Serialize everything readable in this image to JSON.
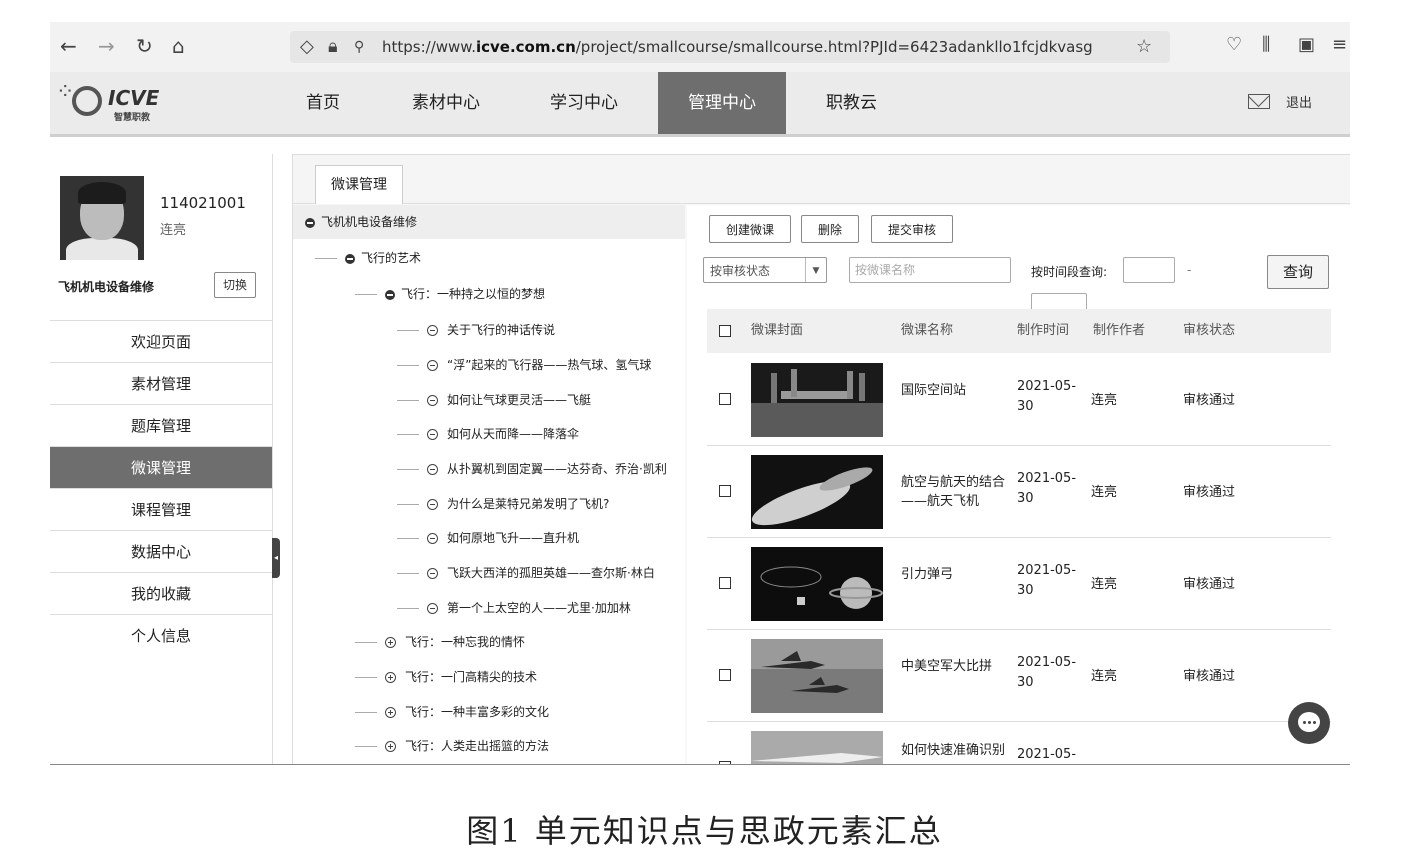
{
  "browser": {
    "url_prefix": "https://www.",
    "url_domain": "icve.com.cn",
    "url_path": "/project/smallcourse/smallcourse.html?PJId=6423adankllo1fcjdkvasg"
  },
  "site": {
    "brand": "icve",
    "brand_sub": "智慧职教",
    "menu": [
      "首页",
      "素材中心",
      "学习中心",
      "管理中心",
      "职教云"
    ],
    "logout": "退出"
  },
  "user": {
    "id": "114021001",
    "name": "连亮",
    "course": "飞机机电设备维修",
    "switch_label": "切换"
  },
  "sidebar": {
    "items": [
      "欢迎页面",
      "素材管理",
      "题库管理",
      "微课管理",
      "课程管理",
      "数据中心",
      "我的收藏",
      "个人信息"
    ]
  },
  "tab": "微课管理",
  "tree": {
    "root": "飞机机电设备维修",
    "level1": "飞行的艺术",
    "level2_open": "飞行：一种持之以恒的梦想",
    "leaves": [
      "关于飞行的神话传说",
      "“浮”起来的飞行器——热气球、氢气球",
      "如何让气球更灵活——飞艇",
      "如何从天而降——降落伞",
      "从扑翼机到固定翼——达芬奇、乔治·凯利",
      "为什么是莱特兄弟发明了飞机?",
      "如何原地飞升——直升机",
      "飞跃大西洋的孤胆英雄——查尔斯·林白",
      "第一个上太空的人——尤里·加加林"
    ],
    "level2_closed": [
      "飞行：一种忘我的情怀",
      "飞行：一门高精尖的技术",
      "飞行：一种丰富多彩的文化",
      "飞行：人类走出摇篮的方法"
    ]
  },
  "toolbar": {
    "create": "创建微课",
    "delete": "删除",
    "submit": "提交审核",
    "status_select": "按审核状态",
    "name_placeholder": "按微课名称",
    "time_label": "按时间段查询:",
    "dash": "-",
    "query": "查询"
  },
  "table": {
    "headers": [
      "微课封面",
      "微课名称",
      "制作时间",
      "制作作者",
      "审核状态"
    ],
    "rows": [
      {
        "name": "国际空间站",
        "time": "2021-05-30",
        "author": "连亮",
        "status": "审核通过"
      },
      {
        "name": "航空与航天的结合——航天飞机",
        "time": "2021-05-30",
        "author": "连亮",
        "status": "审核通过"
      },
      {
        "name": "引力弹弓",
        "time": "2021-05-30",
        "author": "连亮",
        "status": "审核通过"
      },
      {
        "name": "中美空军大比拼",
        "time": "2021-05-30",
        "author": "连亮",
        "status": "审核通过"
      },
      {
        "name": "如何快速准确识别",
        "time": "2021-05-",
        "author": "",
        "status": ""
      }
    ]
  },
  "caption": "图1 单元知识点与思政元素汇总"
}
